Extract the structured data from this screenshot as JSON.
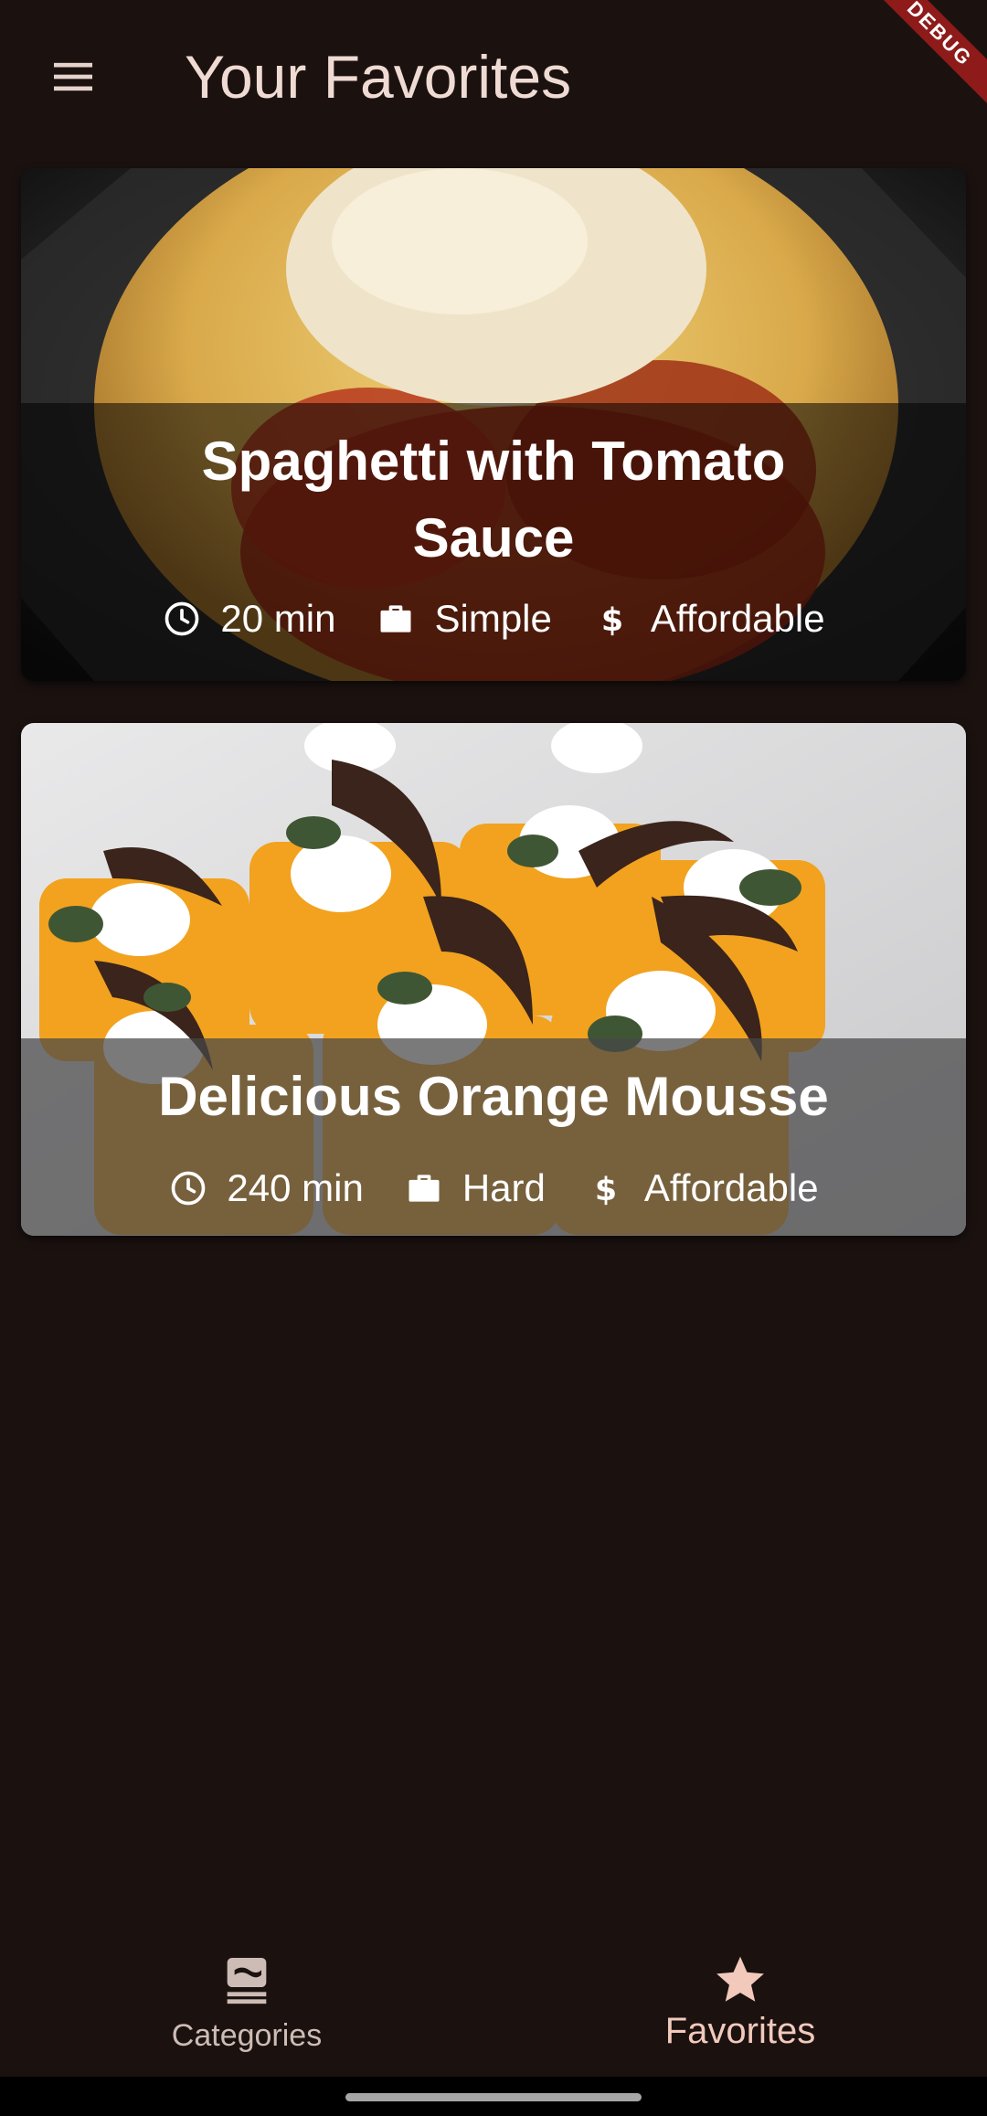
{
  "app": {
    "title": "Your Favorites",
    "debug_banner": "DEBUG"
  },
  "meals": [
    {
      "title": "Spaghetti with Tomato Sauce",
      "duration": "20 min",
      "complexity": "Simple",
      "affordability": "Affordable"
    },
    {
      "title": "Delicious Orange Mousse",
      "duration": "240 min",
      "complexity": "Hard",
      "affordability": "Affordable"
    }
  ],
  "bottom_nav": {
    "items": [
      {
        "label": "Categories",
        "icon": "set-meal-icon",
        "selected": false
      },
      {
        "label": "Favorites",
        "icon": "star-icon",
        "selected": true
      }
    ]
  },
  "colors": {
    "background": "#1b1210",
    "accent": "#f2c9bb",
    "title_text": "#efdbd3"
  }
}
